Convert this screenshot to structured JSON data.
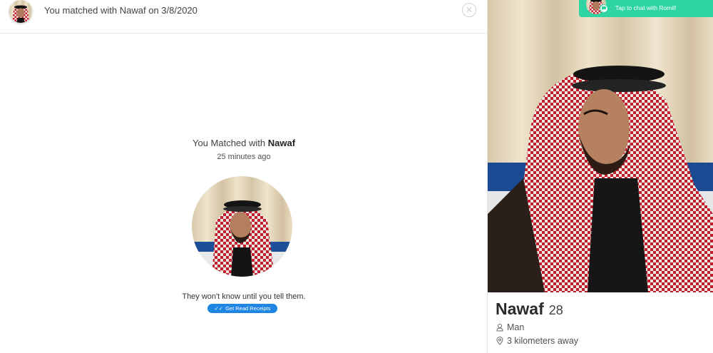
{
  "header": {
    "title": "You matched with Nawaf on 3/8/2020",
    "close_icon": "close-icon"
  },
  "match": {
    "title_prefix": "You Matched with ",
    "name": "Nawaf",
    "time_ago": "25 minutes ago",
    "tagline": "They won't know until you tell them.",
    "receipts_label": "Get Read Receipts",
    "receipts_icon": "double-check-icon"
  },
  "profile": {
    "name": "Nawaf",
    "age": "28",
    "gender": "Man",
    "gender_icon": "person-icon",
    "distance": "3 kilometers away",
    "distance_icon": "location-pin-icon"
  },
  "toast": {
    "text": "Tap to chat with Romil!",
    "badge_icon": "chat-bubble-icon"
  },
  "colors": {
    "accent_blue": "#1f86e4",
    "toast_green": "#2ed5a3",
    "text_dark": "#424242"
  }
}
